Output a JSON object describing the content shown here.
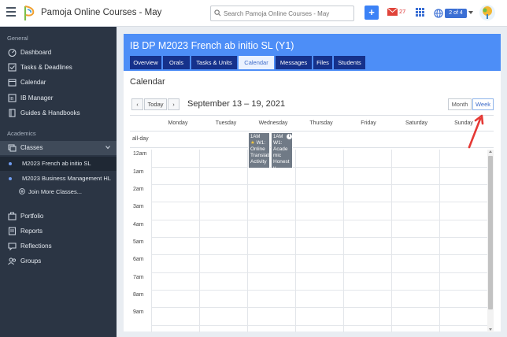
{
  "topbar": {
    "app_title": "Pamoja Online Courses - May",
    "search_placeholder": "Search Pamoja Online Courses - May",
    "mail_count": "27",
    "org_switch": "2 of 4"
  },
  "sidebar": {
    "general_heading": "General",
    "general_items": [
      {
        "label": "Dashboard",
        "icon": "dashboard-icon"
      },
      {
        "label": "Tasks & Deadlines",
        "icon": "tasks-icon"
      },
      {
        "label": "Calendar",
        "icon": "calendar-icon"
      },
      {
        "label": "IB Manager",
        "icon": "ib-manager-icon"
      },
      {
        "label": "Guides & Handbooks",
        "icon": "book-icon"
      }
    ],
    "academics_heading": "Academics",
    "classes_label": "Classes",
    "class_items": [
      "M2023 French ab initio SL",
      "M2023 Business Management HL"
    ],
    "join_label": "Join More Classes...",
    "other_items": [
      {
        "label": "Portfolio",
        "icon": "portfolio-icon"
      },
      {
        "label": "Reports",
        "icon": "reports-icon"
      },
      {
        "label": "Reflections",
        "icon": "reflections-icon"
      },
      {
        "label": "Groups",
        "icon": "groups-icon"
      }
    ]
  },
  "course": {
    "title": "IB DP M2023 French ab initio SL (Y1)",
    "tabs": [
      "Overview",
      "Orals",
      "Tasks & Units",
      "Calendar",
      "Messages",
      "Files",
      "Students"
    ],
    "active_tab": "Calendar"
  },
  "calendar": {
    "section_title": "Calendar",
    "today_label": "Today",
    "range": "September 13 – 19, 2021",
    "view_month": "Month",
    "view_week": "Week",
    "days": [
      "Monday",
      "Tuesday",
      "Wednesday",
      "Thursday",
      "Friday",
      "Saturday",
      "Sunday"
    ],
    "allday_label": "all-day",
    "hours": [
      "12am",
      "1am",
      "2am",
      "3am",
      "4am",
      "5am",
      "6am",
      "7am",
      "8am",
      "9am"
    ],
    "events": [
      {
        "time": "1AM",
        "title": "W1: Online Translati Activity",
        "day": "Wednesday",
        "icon": "star-icon"
      },
      {
        "time": "1AM",
        "title": "W1: Acade mic Honest y Forum",
        "day": "Wednesday",
        "icon": "info-icon"
      }
    ]
  },
  "colors": {
    "banner": "#4d8ef7",
    "tab_bg": "#15318b",
    "sidebar_bg": "#2b3544",
    "event_bg": "#707a86",
    "annotation_arrow": "#e53935"
  }
}
